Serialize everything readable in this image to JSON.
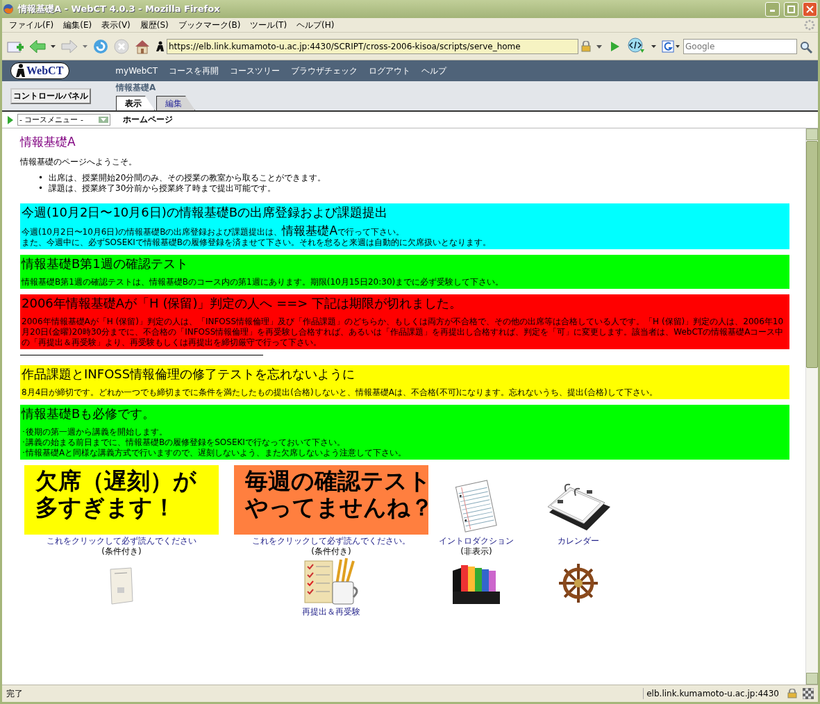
{
  "window": {
    "title": "情報基礎A - WebCT 4.0.3 - Mozilla Firefox"
  },
  "menu": [
    "ファイル(F)",
    "編集(E)",
    "表示(V)",
    "履歴(S)",
    "ブックマーク(B)",
    "ツール(T)",
    "ヘルプ(H)"
  ],
  "address_bar": {
    "value": "https://elb.link.kumamoto-u.ac.jp:4430/SCRIPT/cross-2006-kisoa/scripts/serve_home"
  },
  "search": {
    "placeholder": "Google"
  },
  "webct": {
    "logo": "WebCT",
    "links": [
      "myWebCT",
      "コースを再開",
      "コースツリー",
      "ブラウザチェック",
      "ログアウト",
      "ヘルプ"
    ],
    "control_panel": "コントロールパネル",
    "course": "情報基礎A",
    "tabs": [
      {
        "label": "表示",
        "selected": true
      },
      {
        "label": "編集",
        "selected": false
      }
    ],
    "course_menu": "- コースメニュー -",
    "breadcrumb": "ホームページ"
  },
  "content": {
    "title": "情報基礎A",
    "welcome": "情報基礎のページへようこそ。",
    "bullets": [
      {
        "marker": "•",
        "text": "出席は、授業開始20分間のみ、その授業の教室から取ることができます。"
      },
      {
        "marker": "•",
        "text": "課題は、授業終了30分前から授業終了時まで提出可能です。"
      }
    ],
    "blocks": [
      {
        "kind": "notice",
        "color": "#00ffff",
        "heading": "今週(10月2日〜10月6日)の情報基礎Bの出席登録および課題提出",
        "lines": [
          [
            {
              "text": "今週(10月2日〜10月6日)の情報基礎Bの出席登録および課題提出は、",
              "large": false
            },
            {
              "text": "情報基礎A",
              "large": true
            },
            {
              "text": "で行って下さい。",
              "large": false
            }
          ],
          [
            {
              "text": "また、今週中に、必ずSOSEKIで情報基礎Bの履修登録を済ませて下さい。それを怠ると来週は自動的に欠席扱いとなります。",
              "large": false
            }
          ]
        ]
      },
      {
        "kind": "notice",
        "color": "#00ff00",
        "heading": "情報基礎B第1週の確認テスト",
        "lines": [
          [
            {
              "text": "情報基礎B第1週の確認テストは、情報基礎Bのコース内の第1週にあります。期限(10月15日20:30)までに必ず受験して下さい。",
              "large": false
            }
          ]
        ]
      },
      {
        "kind": "notice",
        "color": "#ff0000",
        "heading": "2006年情報基礎Aが「H (保留)」判定の人へ ==> 下記は期限が切れました。",
        "lines": [
          [
            {
              "text": "2006年情報基礎Aが「H (保留)」判定の人は、「INFOSS情報倫理」及び「作品課題」のどちらか、もしくは両方が不合格で、その他の出席等は合格している人です。「H (保留)」判定の人は、2006年10月20日(金曜)20時30分までに、不合格の「INFOSS情報倫理」を再受験し合格すれば、あるいは「作品課題」を再提出し合格すれば、判定を「可」に変更します。該当者は、WebCTの情報基礎Aコース中の「再提出＆再受験」より、再受験もしくは再提出を締切厳守で行って下さい。",
              "large": false
            }
          ]
        ]
      },
      {
        "kind": "rule"
      },
      {
        "kind": "notice",
        "color": "#ffff00",
        "heading": "作品課題とINFOSS情報倫理の修了テストを忘れないように",
        "lines": [
          [
            {
              "text": "8月4日が締切です。どれか一つでも締切までに条件を満たしたもの提出(合格)しないと、情報基礎Aは、不合格(不可)になります。忘れないうち、提出(合格)して下さい。",
              "large": false
            }
          ]
        ]
      },
      {
        "kind": "notice",
        "color": "#00ff00",
        "heading": "情報基礎Bも必修です。",
        "lines": [
          [
            {
              "text": "･後期の第一週から講義を開始します。",
              "large": false
            }
          ],
          [
            {
              "text": "･講義の始まる前日までに、情報基礎Bの履修登録をSOSEKIで行なっておいて下さい。",
              "large": false
            }
          ],
          [
            {
              "text": "･情報基礎Aと同様な講義方式で行いますので、遅刻しないよう、また欠席しないよう注意して下さい。",
              "large": false
            }
          ]
        ]
      }
    ],
    "tiles": [
      {
        "kind": "banner",
        "color": "#ffff00",
        "banner_lines": [
          "欠席（遅刻）が",
          "多すぎます！"
        ],
        "link": "これをクリックして必ず読んでください",
        "note": "(条件付き)"
      },
      {
        "kind": "banner",
        "color": "#ff7f3f",
        "banner_lines": [
          "毎週の確認テスト",
          "やってませんね？"
        ],
        "link": "これをクリックして必ず読んでください。",
        "note": "(条件付き)"
      },
      {
        "kind": "icon",
        "link": "イントロダクション",
        "note": "(非表示)"
      },
      {
        "kind": "icon",
        "link": "カレンダー"
      },
      {
        "kind": "icon"
      },
      {
        "kind": "icon",
        "link": "再提出＆再受験"
      },
      {
        "kind": "icon"
      },
      {
        "kind": "icon"
      }
    ]
  },
  "status_bar": {
    "text": "完了",
    "host": "elb.link.kumamoto-u.ac.jp:4430"
  }
}
